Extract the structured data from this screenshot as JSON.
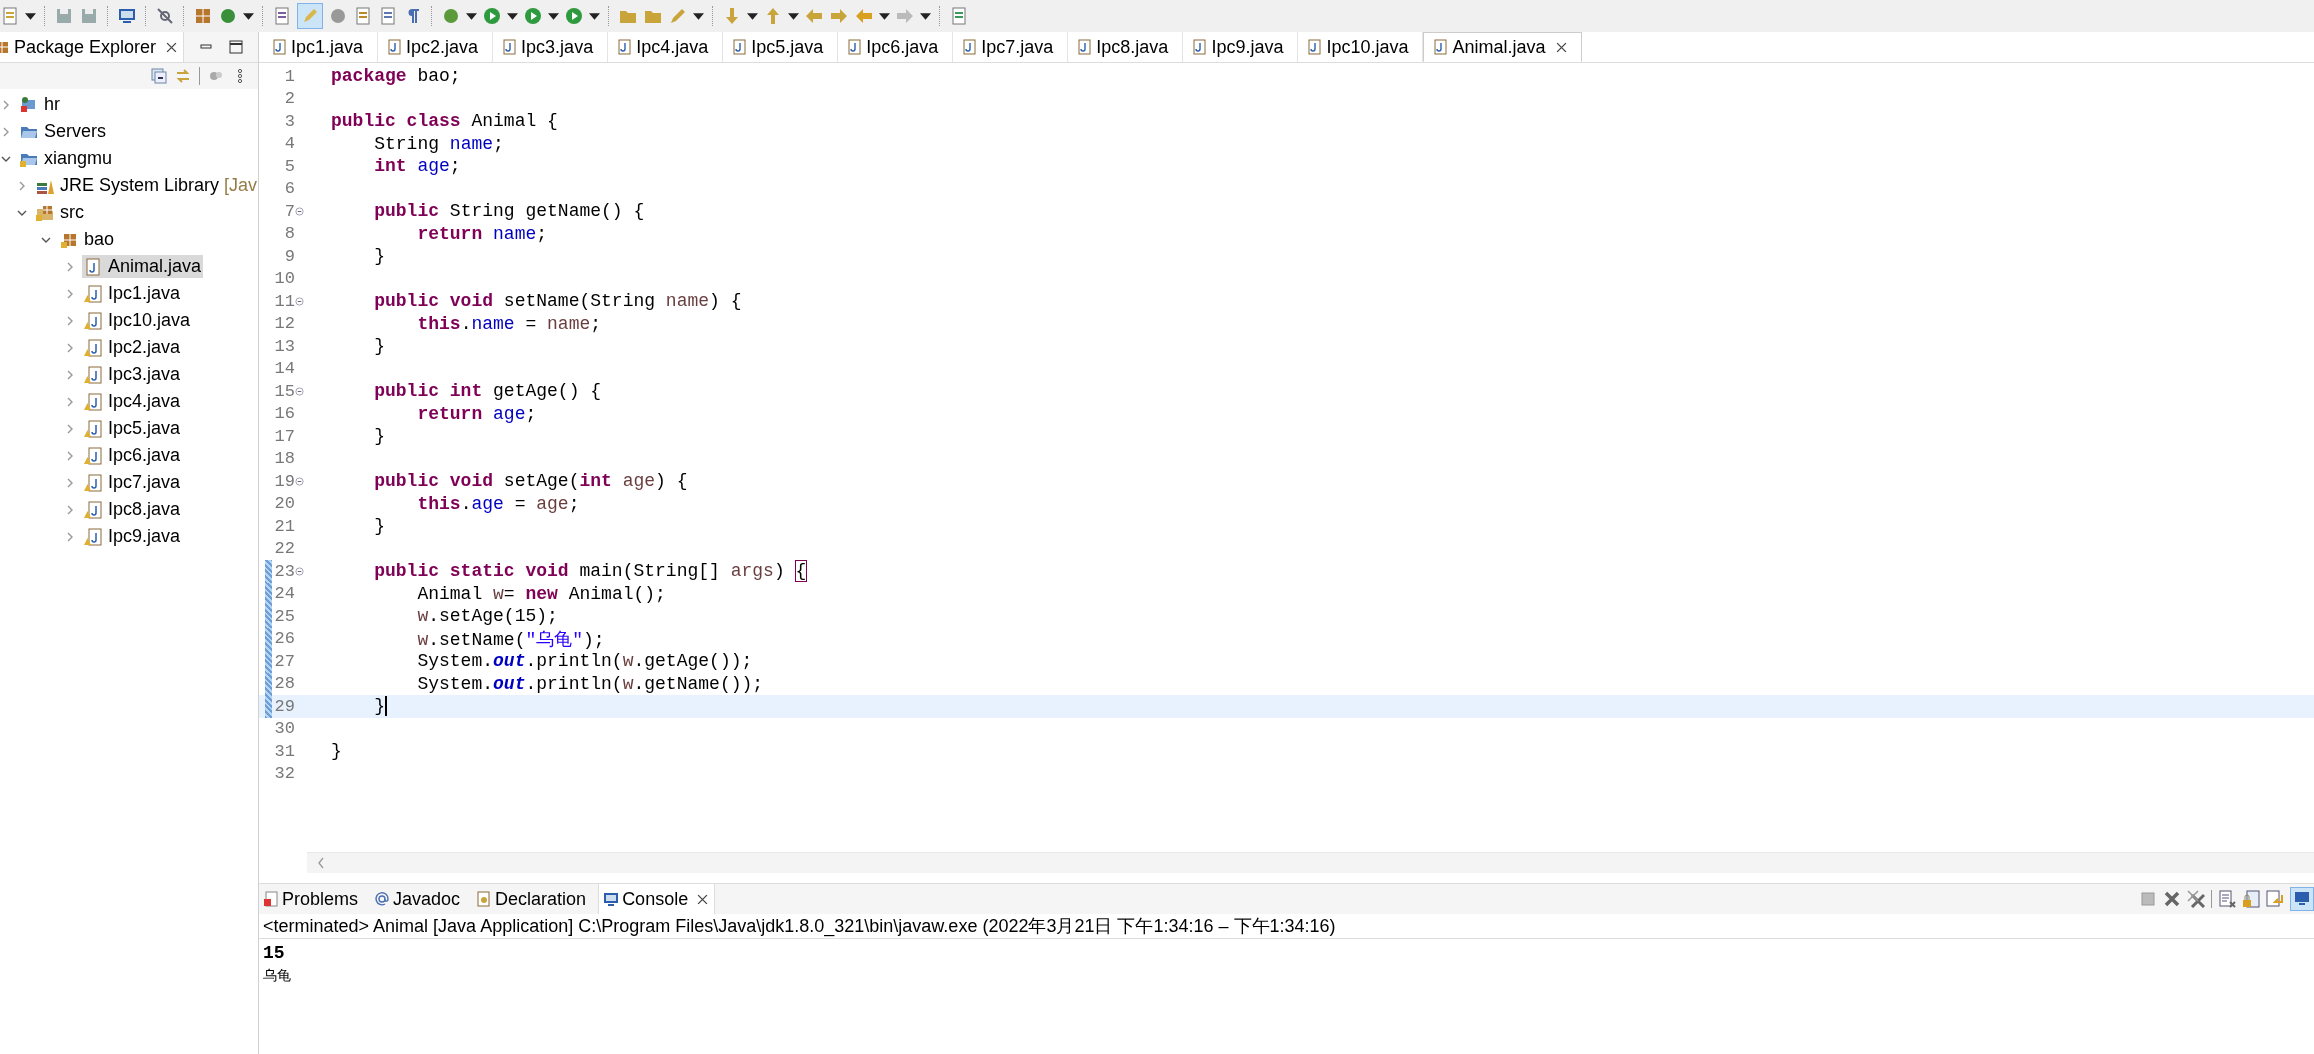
{
  "toolbar": {
    "toggle_pressed": true
  },
  "explorer": {
    "title": "Package Explorer",
    "items": [
      {
        "label": "hr",
        "kind": "project",
        "expanded": false,
        "selected": false
      },
      {
        "label": "Servers",
        "kind": "folder",
        "expanded": false,
        "selected": false
      },
      {
        "label": "xiangmu",
        "kind": "project-open",
        "expanded": true,
        "selected": false,
        "children": [
          {
            "label": "JRE System Library",
            "decoration": "[Jav",
            "kind": "library",
            "expanded": false,
            "selected": false
          },
          {
            "label": "src",
            "kind": "source-folder",
            "expanded": true,
            "selected": false,
            "children": [
              {
                "label": "bao",
                "kind": "package",
                "expanded": true,
                "selected": false,
                "children": [
                  {
                    "label": "Animal.java",
                    "kind": "file",
                    "expanded": false,
                    "selected": true
                  },
                  {
                    "label": "Ipc1.java",
                    "kind": "file-warning",
                    "expanded": false,
                    "selected": false
                  },
                  {
                    "label": "Ipc10.java",
                    "kind": "file-warning",
                    "expanded": false,
                    "selected": false
                  },
                  {
                    "label": "Ipc2.java",
                    "kind": "file-warning",
                    "expanded": false,
                    "selected": false
                  },
                  {
                    "label": "Ipc3.java",
                    "kind": "file-warning",
                    "expanded": false,
                    "selected": false
                  },
                  {
                    "label": "Ipc4.java",
                    "kind": "file-warning",
                    "expanded": false,
                    "selected": false
                  },
                  {
                    "label": "Ipc5.java",
                    "kind": "file-warning",
                    "expanded": false,
                    "selected": false
                  },
                  {
                    "label": "Ipc6.java",
                    "kind": "file-warning",
                    "expanded": false,
                    "selected": false
                  },
                  {
                    "label": "Ipc7.java",
                    "kind": "file-warning",
                    "expanded": false,
                    "selected": false
                  },
                  {
                    "label": "Ipc8.java",
                    "kind": "file-warning",
                    "expanded": false,
                    "selected": false
                  },
                  {
                    "label": "Ipc9.java",
                    "kind": "file-warning",
                    "expanded": false,
                    "selected": false
                  }
                ]
              }
            ]
          }
        ]
      }
    ]
  },
  "editor": {
    "tabs": [
      {
        "label": "Ipc1.java",
        "selected": false
      },
      {
        "label": "Ipc2.java",
        "selected": false
      },
      {
        "label": "Ipc3.java",
        "selected": false
      },
      {
        "label": "Ipc4.java",
        "selected": false
      },
      {
        "label": "Ipc5.java",
        "selected": false
      },
      {
        "label": "Ipc6.java",
        "selected": false
      },
      {
        "label": "Ipc7.java",
        "selected": false
      },
      {
        "label": "Ipc8.java",
        "selected": false
      },
      {
        "label": "Ipc9.java",
        "selected": false
      },
      {
        "label": "Ipc10.java",
        "selected": false
      },
      {
        "label": "Animal.java",
        "selected": true
      }
    ],
    "lines": [
      {
        "number": "1",
        "tokens": [
          {
            "kind": "keyword",
            "text": "package "
          },
          {
            "kind": "plain",
            "text": "bao;"
          }
        ]
      },
      {
        "number": "2"
      },
      {
        "number": "3",
        "tokens": [
          {
            "kind": "keyword",
            "text": "public class "
          },
          {
            "kind": "plain",
            "text": "Animal {"
          }
        ]
      },
      {
        "number": "4",
        "tokens": [
          {
            "kind": "plain",
            "text": "    String "
          },
          {
            "kind": "field",
            "text": "name"
          },
          {
            "kind": "plain",
            "text": ";"
          }
        ]
      },
      {
        "number": "5",
        "tokens": [
          {
            "kind": "keyword",
            "text": "    int "
          },
          {
            "kind": "field",
            "text": "age"
          },
          {
            "kind": "plain",
            "text": ";"
          }
        ]
      },
      {
        "number": "6"
      },
      {
        "number": "7",
        "foldable": true,
        "tokens": [
          {
            "kind": "keyword",
            "text": "    public "
          },
          {
            "kind": "plain",
            "text": "String getName() {"
          }
        ]
      },
      {
        "number": "8",
        "tokens": [
          {
            "kind": "keyword",
            "text": "        return "
          },
          {
            "kind": "field",
            "text": "name"
          },
          {
            "kind": "plain",
            "text": ";"
          }
        ]
      },
      {
        "number": "9",
        "tokens": [
          {
            "kind": "plain",
            "text": "    }"
          }
        ]
      },
      {
        "number": "10"
      },
      {
        "number": "11",
        "foldable": true,
        "tokens": [
          {
            "kind": "keyword",
            "text": "    public void "
          },
          {
            "kind": "plain",
            "text": "setName(String "
          },
          {
            "kind": "local",
            "text": "name"
          },
          {
            "kind": "plain",
            "text": ") {"
          }
        ]
      },
      {
        "number": "12",
        "tokens": [
          {
            "kind": "keyword",
            "text": "        this"
          },
          {
            "kind": "plain",
            "text": "."
          },
          {
            "kind": "field",
            "text": "name"
          },
          {
            "kind": "plain",
            "text": " = "
          },
          {
            "kind": "local",
            "text": "name"
          },
          {
            "kind": "plain",
            "text": ";"
          }
        ]
      },
      {
        "number": "13",
        "tokens": [
          {
            "kind": "plain",
            "text": "    }"
          }
        ]
      },
      {
        "number": "14"
      },
      {
        "number": "15",
        "foldable": true,
        "tokens": [
          {
            "kind": "keyword",
            "text": "    public int "
          },
          {
            "kind": "plain",
            "text": "getAge() {"
          }
        ]
      },
      {
        "number": "16",
        "tokens": [
          {
            "kind": "keyword",
            "text": "        return "
          },
          {
            "kind": "field",
            "text": "age"
          },
          {
            "kind": "plain",
            "text": ";"
          }
        ]
      },
      {
        "number": "17",
        "tokens": [
          {
            "kind": "plain",
            "text": "    }"
          }
        ]
      },
      {
        "number": "18"
      },
      {
        "number": "19",
        "foldable": true,
        "tokens": [
          {
            "kind": "keyword",
            "text": "    public void "
          },
          {
            "kind": "plain",
            "text": "setAge("
          },
          {
            "kind": "keyword",
            "text": "int "
          },
          {
            "kind": "local",
            "text": "age"
          },
          {
            "kind": "plain",
            "text": ") {"
          }
        ]
      },
      {
        "number": "20",
        "tokens": [
          {
            "kind": "keyword",
            "text": "        this"
          },
          {
            "kind": "plain",
            "text": "."
          },
          {
            "kind": "field",
            "text": "age"
          },
          {
            "kind": "plain",
            "text": " = "
          },
          {
            "kind": "local",
            "text": "age"
          },
          {
            "kind": "plain",
            "text": ";"
          }
        ]
      },
      {
        "number": "21",
        "tokens": [
          {
            "kind": "plain",
            "text": "    }"
          }
        ]
      },
      {
        "number": "22"
      },
      {
        "number": "23",
        "foldable": true,
        "changed": true,
        "tokens": [
          {
            "kind": "keyword",
            "text": "    public static void "
          },
          {
            "kind": "plain",
            "text": "main(String[] "
          },
          {
            "kind": "local",
            "text": "args"
          },
          {
            "kind": "plain",
            "text": ") "
          },
          {
            "kind": "bracket-match",
            "text": "{"
          }
        ]
      },
      {
        "number": "24",
        "changed": true,
        "tokens": [
          {
            "kind": "plain",
            "text": "        Animal "
          },
          {
            "kind": "local",
            "text": "w"
          },
          {
            "kind": "plain",
            "text": "= "
          },
          {
            "kind": "keyword",
            "text": "new "
          },
          {
            "kind": "plain",
            "text": "Animal();"
          }
        ]
      },
      {
        "number": "25",
        "changed": true,
        "tokens": [
          {
            "kind": "local",
            "text": "        w"
          },
          {
            "kind": "plain",
            "text": ".setAge(15);"
          }
        ]
      },
      {
        "number": "26",
        "changed": true,
        "tokens": [
          {
            "kind": "local",
            "text": "        w"
          },
          {
            "kind": "plain",
            "text": ".setName("
          },
          {
            "kind": "string",
            "text": "\"乌龟\""
          },
          {
            "kind": "plain",
            "text": ");"
          }
        ]
      },
      {
        "number": "27",
        "changed": true,
        "tokens": [
          {
            "kind": "plain",
            "text": "        System."
          },
          {
            "kind": "static",
            "text": "out"
          },
          {
            "kind": "plain",
            "text": ".println("
          },
          {
            "kind": "local",
            "text": "w"
          },
          {
            "kind": "plain",
            "text": ".getAge());"
          }
        ]
      },
      {
        "number": "28",
        "changed": true,
        "tokens": [
          {
            "kind": "plain",
            "text": "        System."
          },
          {
            "kind": "static",
            "text": "out"
          },
          {
            "kind": "plain",
            "text": ".println("
          },
          {
            "kind": "local",
            "text": "w"
          },
          {
            "kind": "plain",
            "text": ".getName());"
          }
        ]
      },
      {
        "number": "29",
        "changed": true,
        "current": true,
        "tokens": [
          {
            "kind": "plain",
            "text": "    }"
          }
        ]
      },
      {
        "number": "30"
      },
      {
        "number": "31",
        "tokens": [
          {
            "kind": "plain",
            "text": "}"
          }
        ]
      },
      {
        "number": "32"
      }
    ]
  },
  "console": {
    "tabs": [
      {
        "label": "Problems",
        "selected": false
      },
      {
        "label": "Javadoc",
        "selected": false
      },
      {
        "label": "Declaration",
        "selected": false
      },
      {
        "label": "Console",
        "selected": true
      }
    ],
    "header": "<terminated> Animal [Java Application] C:\\Program Files\\Java\\jdk1.8.0_321\\bin\\javaw.exe  (2022年3月21日 下午1:34:16 – 下午1:34:16)",
    "output": [
      {
        "text": "15",
        "kind": "number"
      },
      {
        "text": "乌龟",
        "kind": "text"
      }
    ]
  }
}
